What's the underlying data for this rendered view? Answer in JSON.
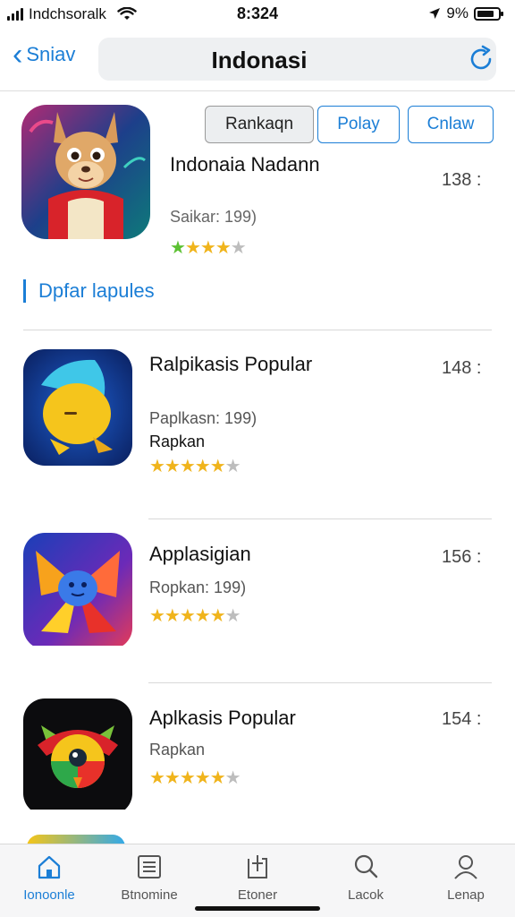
{
  "status_bar": {
    "carrier": "Indchsoralk",
    "time": "8:324",
    "battery": "9%",
    "battery_level": 0.8
  },
  "nav": {
    "back_label": "Sniav",
    "title": "Indonasi"
  },
  "segments": [
    {
      "label": "Rankaqn"
    },
    {
      "label": "Polay"
    },
    {
      "label": "Cnlaw"
    }
  ],
  "featured": {
    "title": "Indonaia Nadann",
    "subtitle": "Saikar: 199)",
    "stars": 4,
    "size": "138 :",
    "icon": "kangaroo-character-icon"
  },
  "section_header": "Dpfar lapules",
  "apps": [
    {
      "name": "Ralpikasis Popular",
      "meta1": "Paplkasn: 199)",
      "meta2": "Rapkan",
      "stars": 4,
      "size": "148 :",
      "icon": "yellow-blob-icon"
    },
    {
      "name": "Applasigian",
      "meta1": "Ropkan: 199)",
      "meta2": "",
      "stars": 4,
      "size": "156 :",
      "icon": "blue-star-face-icon"
    },
    {
      "name": "Aplkasis Popular",
      "meta1": "Rapkan",
      "meta2": "",
      "stars": 4,
      "size": "154 :",
      "icon": "ninja-bird-icon"
    }
  ],
  "tabs": [
    {
      "label": "Ionoonle",
      "icon": "home-icon",
      "active": true
    },
    {
      "label": "Btnomine",
      "icon": "list-icon",
      "active": false
    },
    {
      "label": "Etoner",
      "icon": "download-icon",
      "active": false
    },
    {
      "label": "Lacok",
      "icon": "search-icon",
      "active": false
    },
    {
      "label": "Lenap",
      "icon": "profile-icon",
      "active": false
    }
  ],
  "colors": {
    "accent": "#1b7ed6",
    "star": "#f0b41c"
  }
}
